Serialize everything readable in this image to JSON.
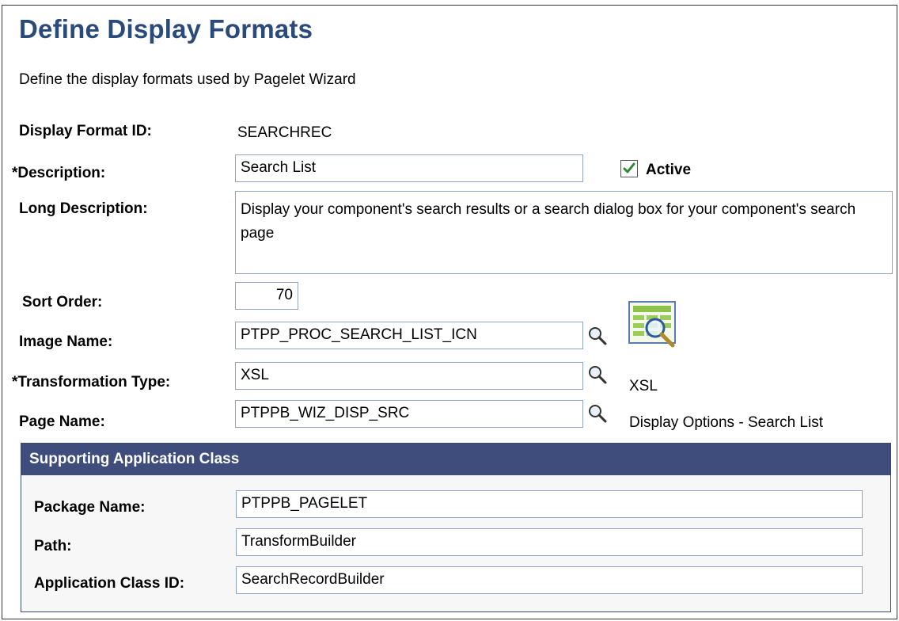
{
  "page": {
    "title": "Define Display Formats",
    "subtitle": "Define the display formats used by Pagelet Wizard"
  },
  "form": {
    "display_format_id_label": "Display Format ID:",
    "display_format_id_value": "SEARCHREC",
    "description_label": "*Description:",
    "description_value": "Search List",
    "active_label": "Active",
    "active_checked": true,
    "long_description_label": "Long Description:",
    "long_description_value": "Display your component's search results or a search dialog box for your component's search page",
    "sort_order_label": "Sort Order:",
    "sort_order_value": "70",
    "image_name_label": "Image Name:",
    "image_name_value": "PTPP_PROC_SEARCH_LIST_ICN",
    "transformation_type_label": "*Transformation Type:",
    "transformation_type_value": "XSL",
    "transformation_type_desc": "XSL",
    "page_name_label": "Page Name:",
    "page_name_value": "PTPPB_WIZ_DISP_SRC",
    "page_name_desc": "Display Options - Search List"
  },
  "supporting_app_class": {
    "header": "Supporting Application Class",
    "package_name_label": "Package Name:",
    "package_name_value": "PTPPB_PAGELET",
    "path_label": "Path:",
    "path_value": "TransformBuilder",
    "app_class_id_label": "Application Class ID:",
    "app_class_id_value": "SearchRecordBuilder"
  },
  "icons": {
    "lookup": "magnifier-lookup-icon",
    "image_preview": "search-list-image-icon",
    "checkmark": "checkmark-icon"
  },
  "colors": {
    "title": "#2b4a7c",
    "group_header_bg": "#3e4d7b",
    "field_border": "#8fa4c0"
  }
}
